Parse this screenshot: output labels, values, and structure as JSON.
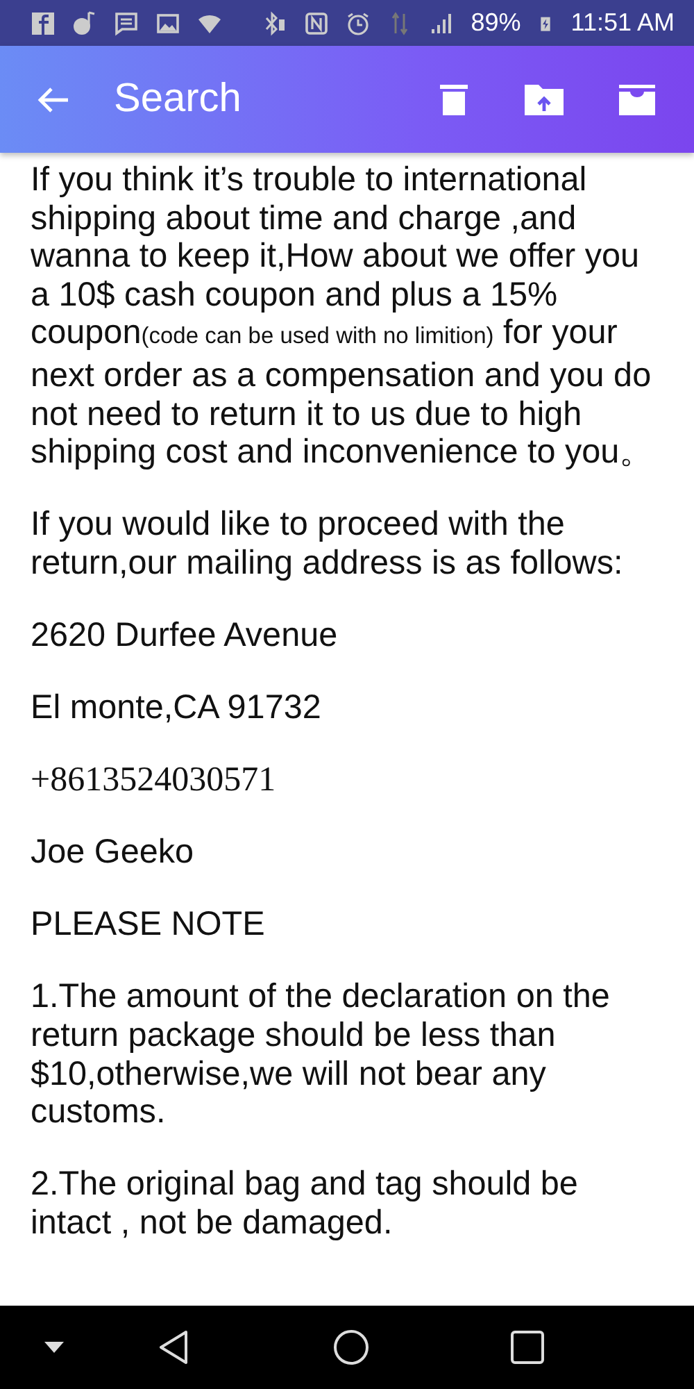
{
  "status_bar": {
    "battery": "89%",
    "time": "11:51 AM"
  },
  "toolbar": {
    "title": "Search"
  },
  "paragraphs": [
    {
      "kind": "text",
      "parts": [
        {
          "text": "If you think it’s trouble to international shipping about time and charge ,and wanna to keep it,How about we offer you a 10$ cash coupon and plus a 15% coupon",
          "small": false
        },
        {
          "text": "(code can be used with no limition)",
          "small": true
        },
        {
          "text": " for your next order as a compensation and you do not need to return it to us due to high shipping cost and inconvenience to you。",
          "small": false
        }
      ]
    },
    {
      "kind": "text",
      "parts": [
        {
          "text": "If you would like to proceed with the return,our mailing address is as follows:",
          "small": false
        }
      ]
    },
    {
      "kind": "text",
      "parts": [
        {
          "text": "2620 Durfee Avenue",
          "small": false
        }
      ]
    },
    {
      "kind": "text",
      "parts": [
        {
          "text": "El monte,CA 91732",
          "small": false
        }
      ]
    },
    {
      "kind": "serif",
      "parts": [
        {
          "text": "+8613524030571",
          "small": false
        }
      ]
    },
    {
      "kind": "text",
      "parts": [
        {
          "text": "Joe Geeko",
          "small": false
        }
      ]
    },
    {
      "kind": "text",
      "parts": [
        {
          "text": "PLEASE NOTE",
          "small": false
        }
      ]
    },
    {
      "kind": "text",
      "parts": [
        {
          "text": "1.The amount of the declaration on the return package should be less than $10,otherwise,we will not bear any customs.",
          "small": false
        }
      ]
    },
    {
      "kind": "text",
      "parts": [
        {
          "text": "2.The original bag and tag should be intact , not be damaged.",
          "small": false
        }
      ]
    }
  ]
}
